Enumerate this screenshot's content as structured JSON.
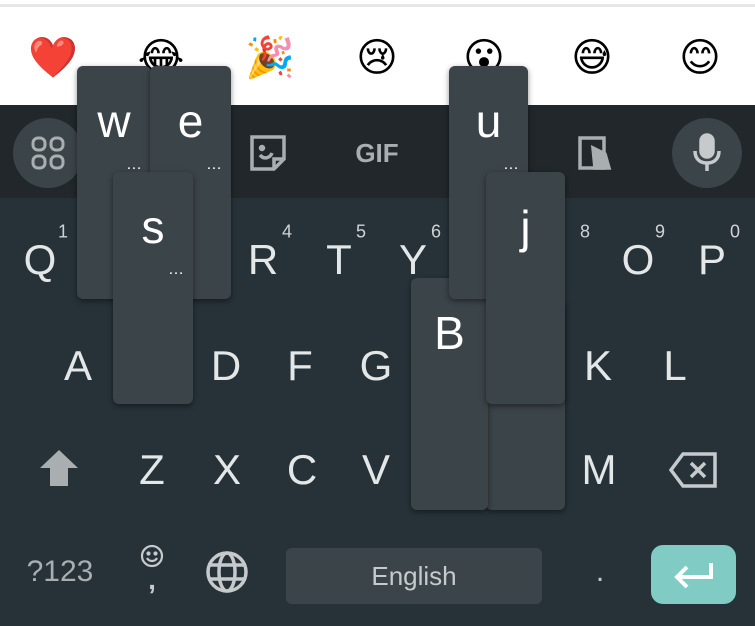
{
  "emoji_suggestions": [
    "❤️",
    "😂",
    "🎉",
    "😢",
    "😮",
    "😅",
    "😊"
  ],
  "toolbar": {
    "apps_icon": "grid-icon",
    "sticker_icon": "sticker-icon",
    "gif_label": "GIF",
    "clipboard_icon": "clipboard-icon",
    "mic_icon": "mic-icon"
  },
  "rows": {
    "row1": [
      {
        "k": "Q",
        "n": "1"
      },
      {
        "k": "R",
        "n": "4"
      },
      {
        "k": "T",
        "n": "5"
      },
      {
        "k": "Y",
        "n": "6"
      },
      {
        "k": "",
        "n": "8"
      },
      {
        "k": "O",
        "n": "9"
      },
      {
        "k": "P",
        "n": "0"
      }
    ],
    "row2": [
      "A",
      "D",
      "F",
      "G",
      "K",
      "L"
    ],
    "row3": [
      "Z",
      "X",
      "C",
      "V",
      "M"
    ]
  },
  "popups": {
    "w": "w",
    "e": "e",
    "s": "s",
    "u": "u",
    "j": "j",
    "b": "B",
    "more": "…"
  },
  "bottom": {
    "symbols": "?123",
    "comma": ",",
    "space": "English",
    "period": "."
  },
  "colors": {
    "keyboard_bg": "#263238",
    "toolbar_bg": "#21272b",
    "key_popup": "#3b4449",
    "enter": "#80cbc4"
  }
}
